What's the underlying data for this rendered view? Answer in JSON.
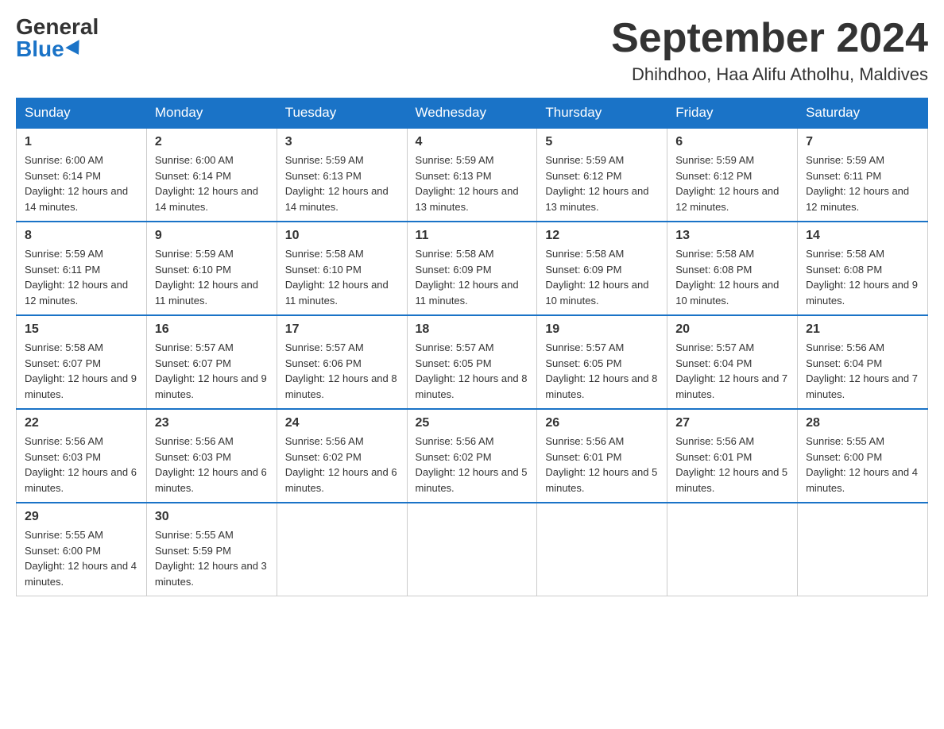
{
  "logo": {
    "general": "General",
    "blue": "Blue"
  },
  "title": {
    "month": "September 2024",
    "location": "Dhihdhoo, Haa Alifu Atholhu, Maldives"
  },
  "weekdays": [
    "Sunday",
    "Monday",
    "Tuesday",
    "Wednesday",
    "Thursday",
    "Friday",
    "Saturday"
  ],
  "weeks": [
    [
      {
        "day": "1",
        "sunrise": "6:00 AM",
        "sunset": "6:14 PM",
        "daylight": "12 hours and 14 minutes."
      },
      {
        "day": "2",
        "sunrise": "6:00 AM",
        "sunset": "6:14 PM",
        "daylight": "12 hours and 14 minutes."
      },
      {
        "day": "3",
        "sunrise": "5:59 AM",
        "sunset": "6:13 PM",
        "daylight": "12 hours and 14 minutes."
      },
      {
        "day": "4",
        "sunrise": "5:59 AM",
        "sunset": "6:13 PM",
        "daylight": "12 hours and 13 minutes."
      },
      {
        "day": "5",
        "sunrise": "5:59 AM",
        "sunset": "6:12 PM",
        "daylight": "12 hours and 13 minutes."
      },
      {
        "day": "6",
        "sunrise": "5:59 AM",
        "sunset": "6:12 PM",
        "daylight": "12 hours and 12 minutes."
      },
      {
        "day": "7",
        "sunrise": "5:59 AM",
        "sunset": "6:11 PM",
        "daylight": "12 hours and 12 minutes."
      }
    ],
    [
      {
        "day": "8",
        "sunrise": "5:59 AM",
        "sunset": "6:11 PM",
        "daylight": "12 hours and 12 minutes."
      },
      {
        "day": "9",
        "sunrise": "5:59 AM",
        "sunset": "6:10 PM",
        "daylight": "12 hours and 11 minutes."
      },
      {
        "day": "10",
        "sunrise": "5:58 AM",
        "sunset": "6:10 PM",
        "daylight": "12 hours and 11 minutes."
      },
      {
        "day": "11",
        "sunrise": "5:58 AM",
        "sunset": "6:09 PM",
        "daylight": "12 hours and 11 minutes."
      },
      {
        "day": "12",
        "sunrise": "5:58 AM",
        "sunset": "6:09 PM",
        "daylight": "12 hours and 10 minutes."
      },
      {
        "day": "13",
        "sunrise": "5:58 AM",
        "sunset": "6:08 PM",
        "daylight": "12 hours and 10 minutes."
      },
      {
        "day": "14",
        "sunrise": "5:58 AM",
        "sunset": "6:08 PM",
        "daylight": "12 hours and 9 minutes."
      }
    ],
    [
      {
        "day": "15",
        "sunrise": "5:58 AM",
        "sunset": "6:07 PM",
        "daylight": "12 hours and 9 minutes."
      },
      {
        "day": "16",
        "sunrise": "5:57 AM",
        "sunset": "6:07 PM",
        "daylight": "12 hours and 9 minutes."
      },
      {
        "day": "17",
        "sunrise": "5:57 AM",
        "sunset": "6:06 PM",
        "daylight": "12 hours and 8 minutes."
      },
      {
        "day": "18",
        "sunrise": "5:57 AM",
        "sunset": "6:05 PM",
        "daylight": "12 hours and 8 minutes."
      },
      {
        "day": "19",
        "sunrise": "5:57 AM",
        "sunset": "6:05 PM",
        "daylight": "12 hours and 8 minutes."
      },
      {
        "day": "20",
        "sunrise": "5:57 AM",
        "sunset": "6:04 PM",
        "daylight": "12 hours and 7 minutes."
      },
      {
        "day": "21",
        "sunrise": "5:56 AM",
        "sunset": "6:04 PM",
        "daylight": "12 hours and 7 minutes."
      }
    ],
    [
      {
        "day": "22",
        "sunrise": "5:56 AM",
        "sunset": "6:03 PM",
        "daylight": "12 hours and 6 minutes."
      },
      {
        "day": "23",
        "sunrise": "5:56 AM",
        "sunset": "6:03 PM",
        "daylight": "12 hours and 6 minutes."
      },
      {
        "day": "24",
        "sunrise": "5:56 AM",
        "sunset": "6:02 PM",
        "daylight": "12 hours and 6 minutes."
      },
      {
        "day": "25",
        "sunrise": "5:56 AM",
        "sunset": "6:02 PM",
        "daylight": "12 hours and 5 minutes."
      },
      {
        "day": "26",
        "sunrise": "5:56 AM",
        "sunset": "6:01 PM",
        "daylight": "12 hours and 5 minutes."
      },
      {
        "day": "27",
        "sunrise": "5:56 AM",
        "sunset": "6:01 PM",
        "daylight": "12 hours and 5 minutes."
      },
      {
        "day": "28",
        "sunrise": "5:55 AM",
        "sunset": "6:00 PM",
        "daylight": "12 hours and 4 minutes."
      }
    ],
    [
      {
        "day": "29",
        "sunrise": "5:55 AM",
        "sunset": "6:00 PM",
        "daylight": "12 hours and 4 minutes."
      },
      {
        "day": "30",
        "sunrise": "5:55 AM",
        "sunset": "5:59 PM",
        "daylight": "12 hours and 3 minutes."
      },
      null,
      null,
      null,
      null,
      null
    ]
  ]
}
